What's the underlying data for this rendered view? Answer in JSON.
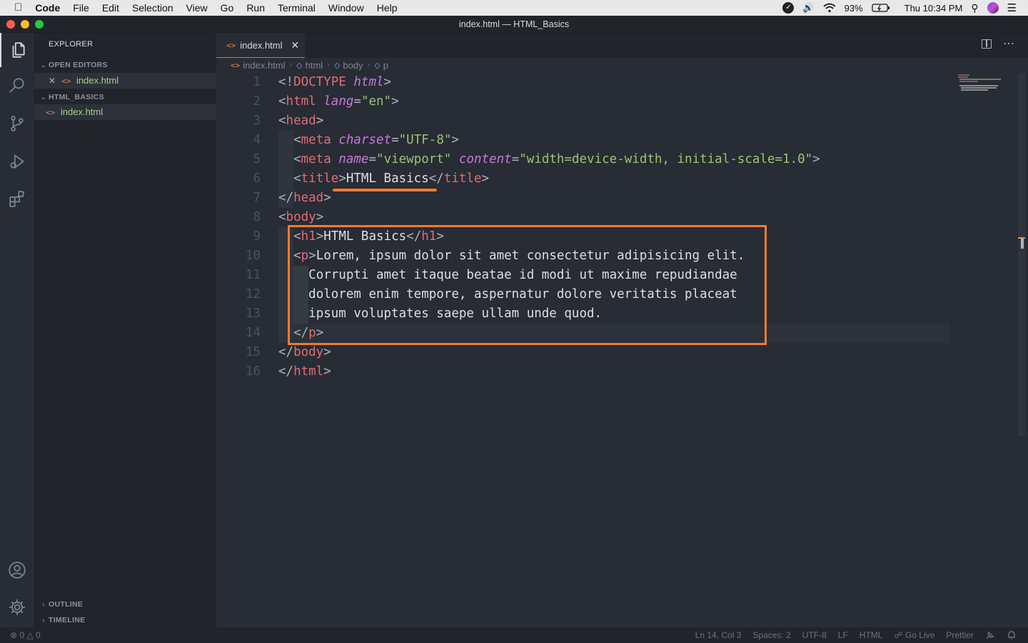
{
  "menubar": {
    "app": "Code",
    "items": [
      "File",
      "Edit",
      "Selection",
      "View",
      "Go",
      "Run",
      "Terminal",
      "Window",
      "Help"
    ],
    "battery": "93%",
    "clock": "Thu 10:34 PM"
  },
  "window": {
    "title": "index.html — HTML_Basics"
  },
  "sidebar": {
    "title": "EXPLORER",
    "open_editors_label": "OPEN EDITORS",
    "open_editors": [
      {
        "name": "index.html"
      }
    ],
    "folder_label": "HTML_BASICS",
    "files": [
      {
        "name": "index.html"
      }
    ],
    "outline_label": "OUTLINE",
    "timeline_label": "TIMELINE"
  },
  "tabs": [
    {
      "label": "index.html"
    }
  ],
  "breadcrumb": [
    "index.html",
    "html",
    "body",
    "p"
  ],
  "code": {
    "line_numbers": [
      "1",
      "2",
      "3",
      "4",
      "5",
      "6",
      "7",
      "8",
      "9",
      "10",
      "11",
      "12",
      "13",
      "14",
      "15",
      "16"
    ],
    "lines": [
      {
        "indent": "",
        "tokens": [
          {
            "c": "br",
            "t": "<!"
          },
          {
            "c": "tg",
            "t": "DOCTYPE"
          },
          {
            "c": "br",
            "t": " "
          },
          {
            "c": "at",
            "t": "html"
          },
          {
            "c": "br",
            "t": ">"
          }
        ]
      },
      {
        "indent": "",
        "tokens": [
          {
            "c": "br",
            "t": "<"
          },
          {
            "c": "tg",
            "t": "html"
          },
          {
            "c": "br",
            "t": " "
          },
          {
            "c": "at",
            "t": "lang"
          },
          {
            "c": "br",
            "t": "="
          },
          {
            "c": "st",
            "t": "\"en\""
          },
          {
            "c": "br",
            "t": ">"
          }
        ]
      },
      {
        "indent": "",
        "tokens": [
          {
            "c": "br",
            "t": "<"
          },
          {
            "c": "tg",
            "t": "head"
          },
          {
            "c": "br",
            "t": ">"
          }
        ]
      },
      {
        "indent": "  ",
        "tokens": [
          {
            "c": "br",
            "t": "<"
          },
          {
            "c": "tg",
            "t": "meta"
          },
          {
            "c": "br",
            "t": " "
          },
          {
            "c": "at",
            "t": "charset"
          },
          {
            "c": "br",
            "t": "="
          },
          {
            "c": "st",
            "t": "\"UTF-8\""
          },
          {
            "c": "br",
            "t": ">"
          }
        ]
      },
      {
        "indent": "  ",
        "tokens": [
          {
            "c": "br",
            "t": "<"
          },
          {
            "c": "tg",
            "t": "meta"
          },
          {
            "c": "br",
            "t": " "
          },
          {
            "c": "at",
            "t": "name"
          },
          {
            "c": "br",
            "t": "="
          },
          {
            "c": "st",
            "t": "\"viewport\""
          },
          {
            "c": "br",
            "t": " "
          },
          {
            "c": "at",
            "t": "content"
          },
          {
            "c": "br",
            "t": "="
          },
          {
            "c": "st",
            "t": "\"width=device-width, initial-scale=1.0\""
          },
          {
            "c": "br",
            "t": ">"
          }
        ]
      },
      {
        "indent": "  ",
        "tokens": [
          {
            "c": "br",
            "t": "<"
          },
          {
            "c": "tg",
            "t": "title"
          },
          {
            "c": "br",
            "t": ">"
          },
          {
            "c": "tx",
            "t": "HTML Basics"
          },
          {
            "c": "br",
            "t": "</"
          },
          {
            "c": "tg",
            "t": "title"
          },
          {
            "c": "br",
            "t": ">"
          }
        ]
      },
      {
        "indent": "",
        "tokens": [
          {
            "c": "br",
            "t": "</"
          },
          {
            "c": "tg",
            "t": "head"
          },
          {
            "c": "br",
            "t": ">"
          }
        ]
      },
      {
        "indent": "",
        "tokens": [
          {
            "c": "br",
            "t": "<"
          },
          {
            "c": "tg",
            "t": "body"
          },
          {
            "c": "br",
            "t": ">"
          }
        ]
      },
      {
        "indent": "  ",
        "tokens": [
          {
            "c": "br",
            "t": "<"
          },
          {
            "c": "tg",
            "t": "h1"
          },
          {
            "c": "br",
            "t": ">"
          },
          {
            "c": "tx",
            "t": "HTML Basics"
          },
          {
            "c": "br",
            "t": "</"
          },
          {
            "c": "tg",
            "t": "h1"
          },
          {
            "c": "br",
            "t": ">"
          }
        ]
      },
      {
        "indent": "  ",
        "tokens": [
          {
            "c": "br",
            "t": "<"
          },
          {
            "c": "tg",
            "t": "p"
          },
          {
            "c": "br",
            "t": ">"
          },
          {
            "c": "tx",
            "t": "Lorem, ipsum dolor sit amet consectetur adipisicing elit."
          }
        ]
      },
      {
        "indent": "    ",
        "tokens": [
          {
            "c": "tx",
            "t": "Corrupti amet itaque beatae id modi ut maxime repudiandae"
          }
        ]
      },
      {
        "indent": "    ",
        "tokens": [
          {
            "c": "tx",
            "t": "dolorem enim tempore, aspernatur dolore veritatis placeat"
          }
        ]
      },
      {
        "indent": "    ",
        "tokens": [
          {
            "c": "tx",
            "t": "ipsum voluptates saepe ullam unde quod."
          }
        ]
      },
      {
        "indent": "  ",
        "tokens": [
          {
            "c": "br",
            "t": "</"
          },
          {
            "c": "tg",
            "t": "p"
          },
          {
            "c": "br",
            "t": ">"
          }
        ]
      },
      {
        "indent": "",
        "tokens": [
          {
            "c": "br",
            "t": "</"
          },
          {
            "c": "tg",
            "t": "body"
          },
          {
            "c": "br",
            "t": ">"
          }
        ]
      },
      {
        "indent": "",
        "tokens": [
          {
            "c": "br",
            "t": "</"
          },
          {
            "c": "tg",
            "t": "html"
          },
          {
            "c": "br",
            "t": ">"
          }
        ]
      }
    ]
  },
  "status": {
    "errors": "0",
    "warnings": "0",
    "position": "Ln 14, Col 3",
    "spaces": "Spaces: 2",
    "encoding": "UTF-8",
    "eol": "LF",
    "language": "HTML",
    "golive": "Go Live",
    "prettier": "Prettier"
  },
  "colors": {
    "accent": "#ec7b37",
    "tag": "#e06c75",
    "attr": "#c678dd",
    "string": "#98c379"
  }
}
